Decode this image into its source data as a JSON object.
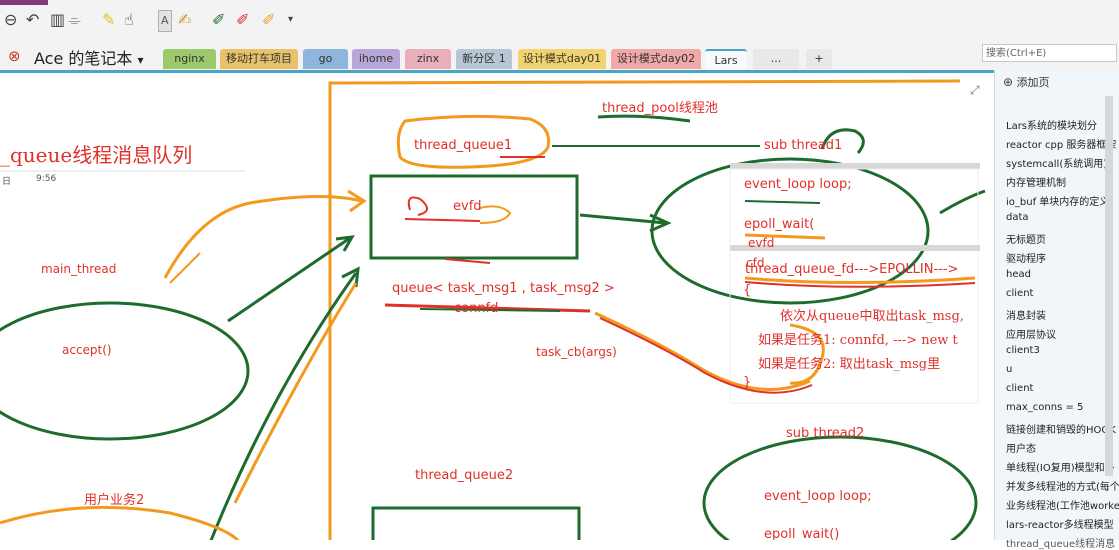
{
  "toolbar": {
    "icons": [
      "back-icon",
      "undo-icon",
      "view-icon",
      "highlighter-icon",
      "ink-icon",
      "text-ink-icon",
      "pen-green-icon",
      "pen-red-icon",
      "pen-orange-icon",
      "more-icon"
    ]
  },
  "notebook": {
    "title": "Ace 的笔记本",
    "dropdown": "▾"
  },
  "tabs": [
    {
      "label": "nginx",
      "color": "#9cc96b"
    },
    {
      "label": "移动打车项目",
      "color": "#e7c26a"
    },
    {
      "label": "go",
      "color": "#8fb5dd"
    },
    {
      "label": "ihome",
      "color": "#b7a6d8"
    },
    {
      "label": "zinx",
      "color": "#e9b0bc"
    },
    {
      "label": "新分区 1",
      "color": "#b9c6d6"
    },
    {
      "label": "设计模式day01",
      "color": "#f2d36f"
    },
    {
      "label": "设计模式day02",
      "color": "#f0a8a8"
    },
    {
      "label": "Lars",
      "color": "#9ac7e0"
    },
    {
      "label": "...",
      "color": "#e8e8e8"
    },
    {
      "label": "+",
      "color": "#e8e8e8"
    }
  ],
  "search": {
    "placeholder": "搜索(Ctrl+E)"
  },
  "canvas": {
    "page_title": "_queue线程消息队列",
    "date_label": "日",
    "time_label": "9:56",
    "labels": {
      "thread_pool": "thread_pool线程池",
      "thread_queue1": "thread_queue1",
      "sub_thread1": "sub thread1",
      "evfd": "evfd",
      "main_thread": "main_thread",
      "queue_msg": "queue<  task_msg1 , task_msg2 >",
      "connfd": "connfd",
      "accept": "accept()",
      "task_cb": "task_cb(args)",
      "event_loop1": "event_loop loop;",
      "epoll_wait1": "epoll_wait(",
      "evfd2": "evfd",
      "cfd": "cfd",
      "thread_queue_fd": "thread_queue_fd--->EPOLLIN--->",
      "brace_open": "{",
      "take_msg": "依次从queue中取出task_msg,",
      "task1": "如果是任务1:   connfd, ---> new t",
      "task2": "如果是任务2:    取出task_msg里",
      "brace_close": "}",
      "sub_thread2": "sub thread2",
      "thread_queue2": "thread_queue2",
      "user_task2": "用户业务2",
      "event_loop2": "event_loop loop;",
      "epoll_wait2": "epoll_wait()"
    }
  },
  "sidebar": {
    "add_page": "添加页",
    "pages": [
      "Lars系统的模块划分",
      "reactor cpp 服务器框架",
      "systemcall(系统调用)",
      "内存管理机制",
      "io_buf 单块内存的定义",
      "data",
      "无标题页",
      "驱动程序",
      "head",
      "client",
      "消息封装",
      "应用层协议",
      "client3",
      "u",
      "client",
      "max_conns = 5",
      "链接创建和销毁的HOOK",
      "用户态",
      "单线程(IO复用)模型和多",
      "并发多线程池的方式(每个",
      "业务线程池(工作池worke",
      "lars-reactor多线程模型",
      "thread_queue线程消息"
    ]
  },
  "colors": {
    "accent": "#4aa3c9",
    "ink_red": "#e0302a",
    "ink_green": "#1e6b2e",
    "ink_orange": "#f39a1e"
  }
}
